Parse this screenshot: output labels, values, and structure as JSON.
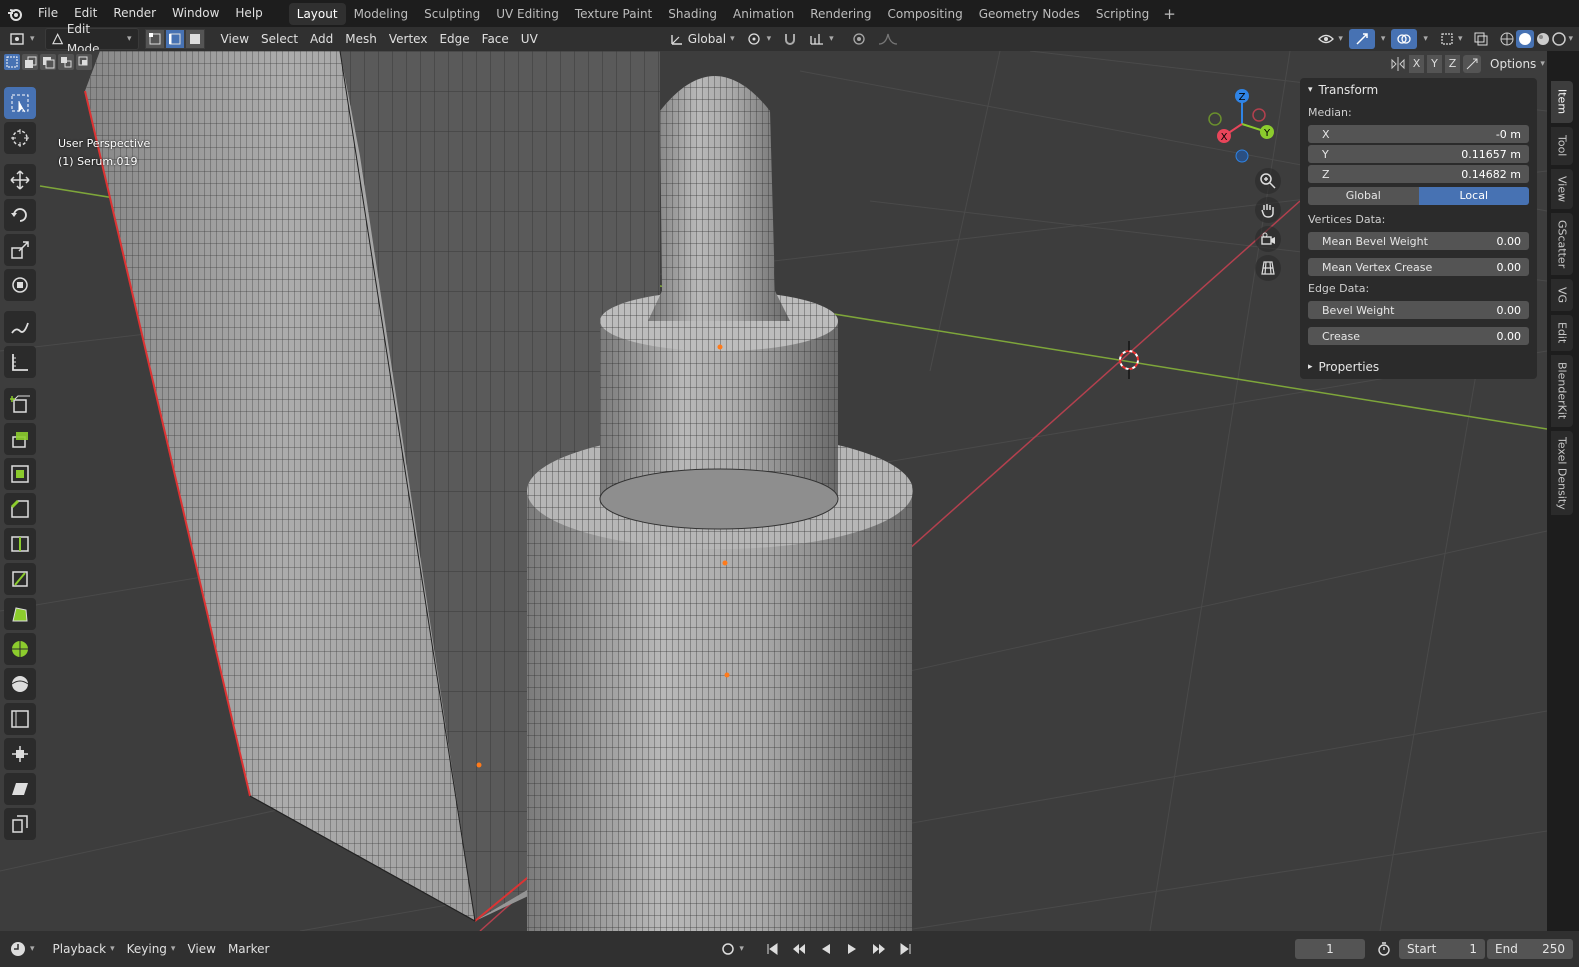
{
  "topbar": {
    "menus": [
      "File",
      "Edit",
      "Render",
      "Window",
      "Help"
    ],
    "workspaces": [
      "Layout",
      "Modeling",
      "Sculpting",
      "UV Editing",
      "Texture Paint",
      "Shading",
      "Animation",
      "Rendering",
      "Compositing",
      "Geometry Nodes",
      "Scripting"
    ],
    "active_workspace": "Layout",
    "add_label": "+"
  },
  "header": {
    "mode": "Edit Mode",
    "menus": [
      "View",
      "Select",
      "Add",
      "Mesh",
      "Vertex",
      "Edge",
      "Face",
      "UV"
    ],
    "orientation": "Global",
    "options_label": "Options",
    "axes": [
      "X",
      "Y",
      "Z"
    ]
  },
  "viewport": {
    "perspective": "User Perspective",
    "object": "(1) Serum.019"
  },
  "gizmo": {
    "x": "X",
    "y": "Y",
    "z": "Z"
  },
  "npanel": {
    "transform_title": "Transform",
    "median_label": "Median:",
    "x_label": "X",
    "x_value": "-0 m",
    "y_label": "Y",
    "y_value": "0.11657 m",
    "z_label": "Z",
    "z_value": "0.14682 m",
    "global_label": "Global",
    "local_label": "Local",
    "vertices_data_label": "Vertices Data:",
    "mean_bevel_label": "Mean Bevel Weight",
    "mean_bevel_value": "0.00",
    "mean_crease_label": "Mean Vertex Crease",
    "mean_crease_value": "0.00",
    "edge_data_label": "Edge Data:",
    "bevel_label": "Bevel Weight",
    "bevel_value": "0.00",
    "crease_label": "Crease",
    "crease_value": "0.00",
    "properties_label": "Properties"
  },
  "side_tabs": [
    "Item",
    "Tool",
    "View",
    "GScatter",
    "VG",
    "Edit",
    "BlenderKit",
    "Texel Density"
  ],
  "timeline": {
    "playback": "Playback",
    "keying": "Keying",
    "view": "View",
    "marker": "Marker",
    "current_frame": "1",
    "start_label": "Start",
    "start_value": "1",
    "end_label": "End",
    "end_value": "250"
  },
  "colors": {
    "accent": "#4772b3",
    "axis_x": "#e8455a",
    "axis_y": "#8ccc2d",
    "axis_z": "#2f84e6"
  }
}
